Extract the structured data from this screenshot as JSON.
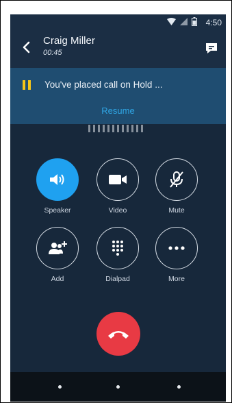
{
  "status_bar": {
    "time": "4:50"
  },
  "header": {
    "contact_name": "Craig Miller",
    "call_duration": "00:45"
  },
  "hold_banner": {
    "message": "You've placed call on Hold ...",
    "resume_label": "Resume"
  },
  "controls": [
    {
      "label": "Speaker",
      "icon": "speaker-icon",
      "active": true
    },
    {
      "label": "Video",
      "icon": "video-camera-icon",
      "active": false
    },
    {
      "label": "Mute",
      "icon": "microphone-muted-icon",
      "active": false
    },
    {
      "label": "Add",
      "icon": "add-person-icon",
      "active": false
    },
    {
      "label": "Dialpad",
      "icon": "dialpad-icon",
      "active": false
    },
    {
      "label": "More",
      "icon": "more-dots-icon",
      "active": false
    }
  ],
  "colors": {
    "background": "#17283b",
    "hold_banner": "#1f4d71",
    "accent": "#1fa1f0",
    "end_call": "#e83a44",
    "hold_icon": "#f5c518"
  }
}
